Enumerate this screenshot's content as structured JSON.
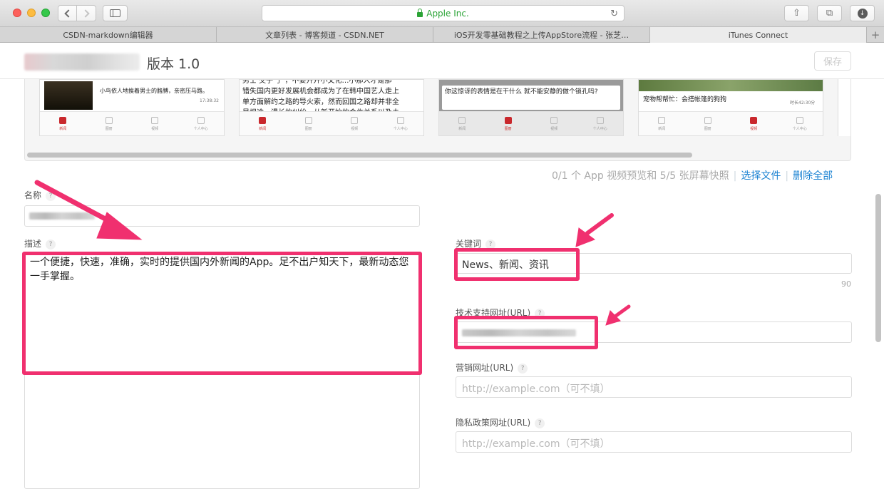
{
  "browser": {
    "address": "Apple Inc.",
    "tabs": [
      "CSDN-markdown编辑器",
      "文章列表 - 博客频道 - CSDN.NET",
      "iOS开发零基础教程之上传AppStore流程 - 张芝…",
      "iTunes Connect"
    ],
    "new_tab": "+"
  },
  "header": {
    "version_title": "版本 1.0",
    "save_label": "保存"
  },
  "screenshots": {
    "shot1": {
      "text": "小鸟依人地挨着男士的胳膊，亲密压马路。",
      "time": "17:38:32",
      "tabs": [
        "新闻",
        "图册",
        "视频",
        "个人中心"
      ]
    },
    "shot2": {
      "lines": [
        "男士 交子 了 ，不要开开小文化…小那人才是那",
        "错失国内更好发展机会都成为了在韩中国艺人走上",
        "单方面解约之路的导火索，然而回国之路却并非全",
        "是坦途，漫长的纠纷、从新开始的合作关系以及未"
      ],
      "tabs": [
        "新闻",
        "图册",
        "视频",
        "个人中心"
      ]
    },
    "shot3": {
      "text": "你这惊讶的表情是在干什么 就不能安静的做个锁孔吗?",
      "tabs": [
        "新闻",
        "图册",
        "视频",
        "个人中心"
      ]
    },
    "shot4": {
      "text": "宠物帮帮忙：会搭帐篷的狗狗",
      "time": "时长42:30分",
      "tabs": [
        "新闻",
        "图册",
        "视频",
        "个人中心"
      ]
    }
  },
  "media": {
    "info": "0/1 个 App 视频预览和 5/5 张屏幕快照",
    "choose_file": "选择文件",
    "delete_all": "删除全部",
    "separator": "|"
  },
  "form": {
    "name_label": "名称",
    "description_label": "描述",
    "description_value": "一个便捷，快速，准确，实时的提供国内外新闻的App。足不出户知天下，最新动态您一手掌握。",
    "keywords_label": "关键词",
    "keywords_value": "News、新闻、资讯",
    "keywords_counter": "90",
    "support_url_label": "技术支持网址(URL)",
    "marketing_url_label": "营销网址(URL)",
    "marketing_url_placeholder": "http://example.com（可不填）",
    "privacy_url_label": "隐私政策网址(URL)",
    "privacy_url_placeholder": "http://example.com（可不填）",
    "help_glyph": "?"
  },
  "colors": {
    "highlight": "#f0306f",
    "link": "#1a82d2",
    "lock": "#2aa335"
  }
}
